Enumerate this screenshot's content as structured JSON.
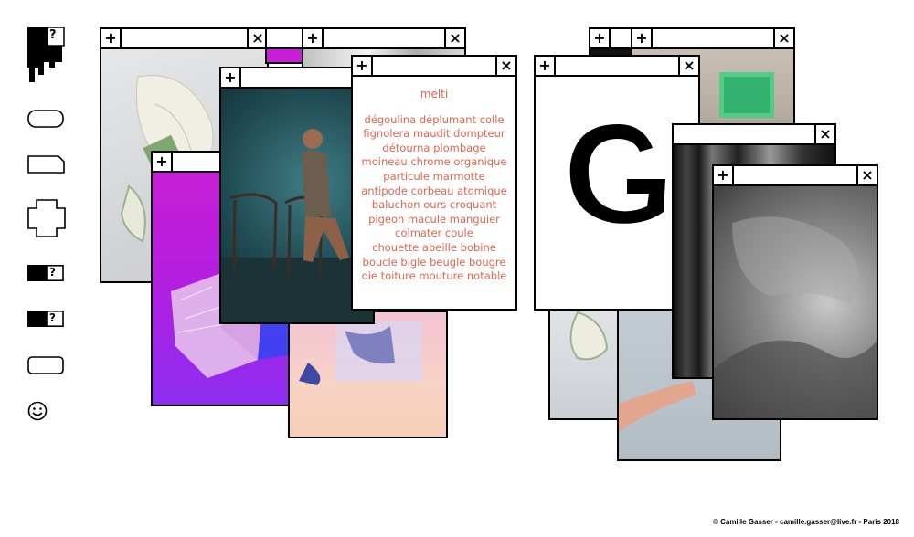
{
  "sidebar": {
    "items": [
      {
        "icon": "pixel-figure-question-icon"
      },
      {
        "icon": "rounded-rectangle-icon"
      },
      {
        "icon": "tag-shape-icon"
      },
      {
        "icon": "cross-shape-icon"
      },
      {
        "icon": "black-box-question-icon",
        "label": "?"
      },
      {
        "icon": "black-box-question-icon",
        "label": "?"
      },
      {
        "icon": "rounded-rectangle-icon"
      },
      {
        "icon": "smiley-icon"
      }
    ],
    "logo_label": "?"
  },
  "windows": {
    "plus": "+",
    "close": "×"
  },
  "poem": {
    "title": "melti",
    "lines": [
      "dégoulina déplumant colle",
      "fignolera maudit dompteur",
      "détourna plombage",
      "moineau chrome organique",
      "particule marmotte",
      "antipode corbeau atomique",
      "baluchon ours croquant",
      "pigeon macule manguier",
      "colmater coule",
      "chouette abeille bobine",
      "boucle bigle beugle bougre",
      "oie toiture mouture notable"
    ]
  },
  "footer": {
    "credit": "© Camille Gasser - camille.gasser@live.fr - Paris 2018"
  },
  "colors": {
    "poem_text": "#e2654d",
    "magenta": "#c81fd6",
    "frame": "#000000"
  }
}
